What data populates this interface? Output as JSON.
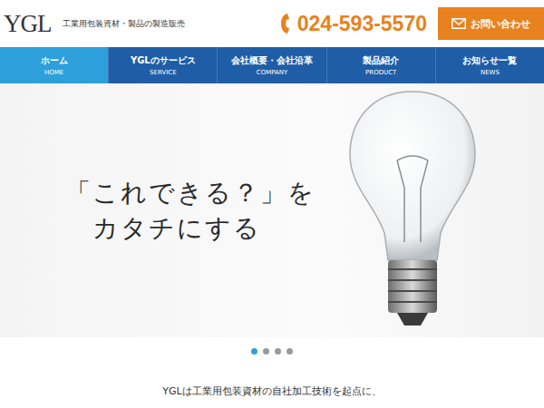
{
  "header": {
    "logo": "YGL",
    "tagline": "工業用包装資材・製品の製造販売",
    "phone": "024-593-5570",
    "contact_button": "お問い合わせ"
  },
  "nav": [
    {
      "label": "ホーム",
      "sub": "HOME",
      "selected": true
    },
    {
      "label": "YGLのサービス",
      "sub": "SERVICE",
      "selected": false
    },
    {
      "label": "会社概要・会社沿革",
      "sub": "COMPANY",
      "selected": false
    },
    {
      "label": "製品紹介",
      "sub": "PRODUCT",
      "selected": false
    },
    {
      "label": "お知らせ一覧",
      "sub": "NEWS",
      "selected": false
    }
  ],
  "hero": {
    "headline": [
      "「これできる？」を",
      "カタチにする"
    ]
  },
  "slider_dots": [
    {
      "selected": true
    },
    {
      "selected": false
    },
    {
      "selected": false
    },
    {
      "selected": false
    }
  ],
  "intro": "YGLは工業用包装資材の自社加工技術を起点に、"
}
